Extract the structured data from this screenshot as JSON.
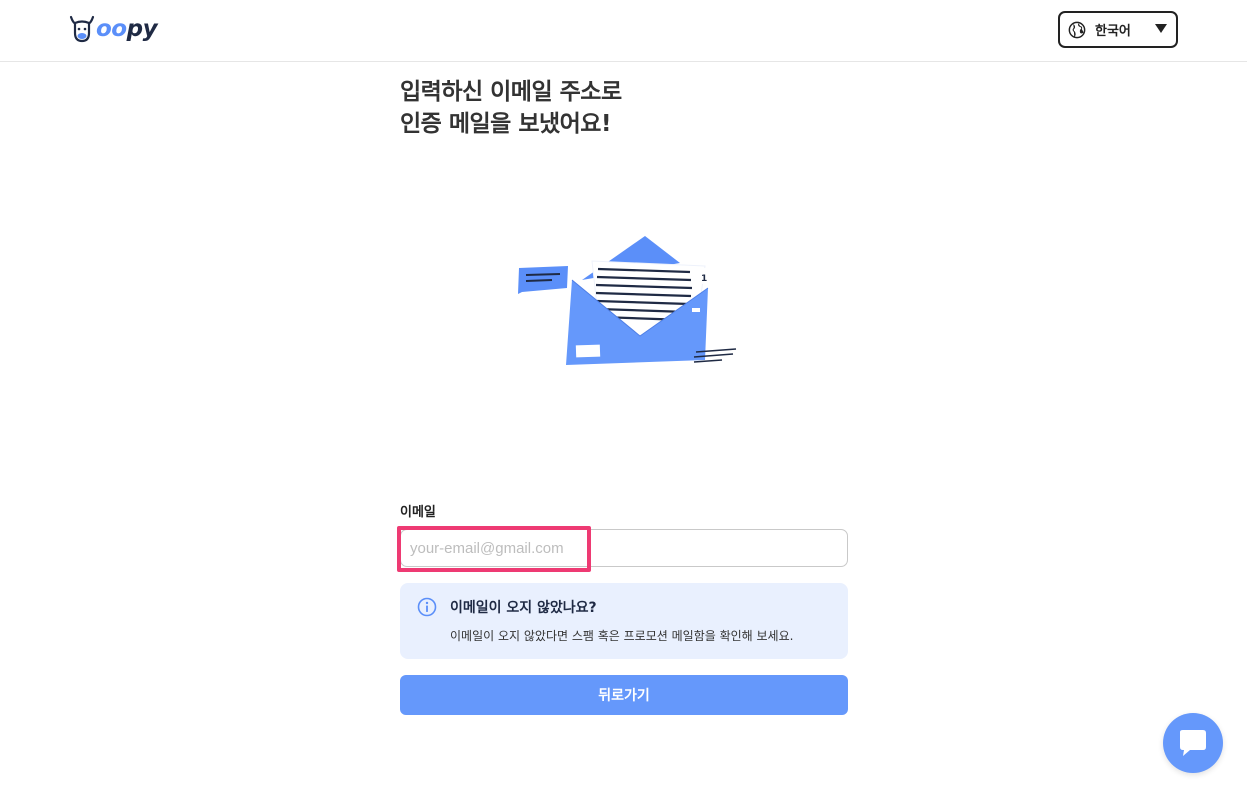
{
  "header": {
    "logo": {
      "prefix": "",
      "accent": "oo",
      "suffix": "py",
      "icon": "cow-head-icon"
    },
    "language": {
      "label": "한국어",
      "icon": "globe-icon",
      "caret": "caret-down-icon"
    }
  },
  "main": {
    "title_line1": "입력하신 이메일 주소로",
    "title_line2": "인증 메일을 보냈어요!",
    "illustration": "open-envelope-illustration",
    "email": {
      "label": "이메일",
      "value": "",
      "placeholder": "your-email@gmail.com"
    },
    "notice": {
      "icon": "info-icon",
      "title": "이메일이 오지 않았나요?",
      "body": "이메일이 오지 않았다면 스팸 혹은 프로모션 메일함을 확인해 보세요."
    },
    "back_button": "뒤로가기"
  },
  "chat": {
    "icon": "chat-bubble-icon"
  },
  "colors": {
    "accent": "#6598fb",
    "highlight": "#ee3a73",
    "notice_bg": "#e9f0fe",
    "text_dark": "#1f2a44"
  }
}
